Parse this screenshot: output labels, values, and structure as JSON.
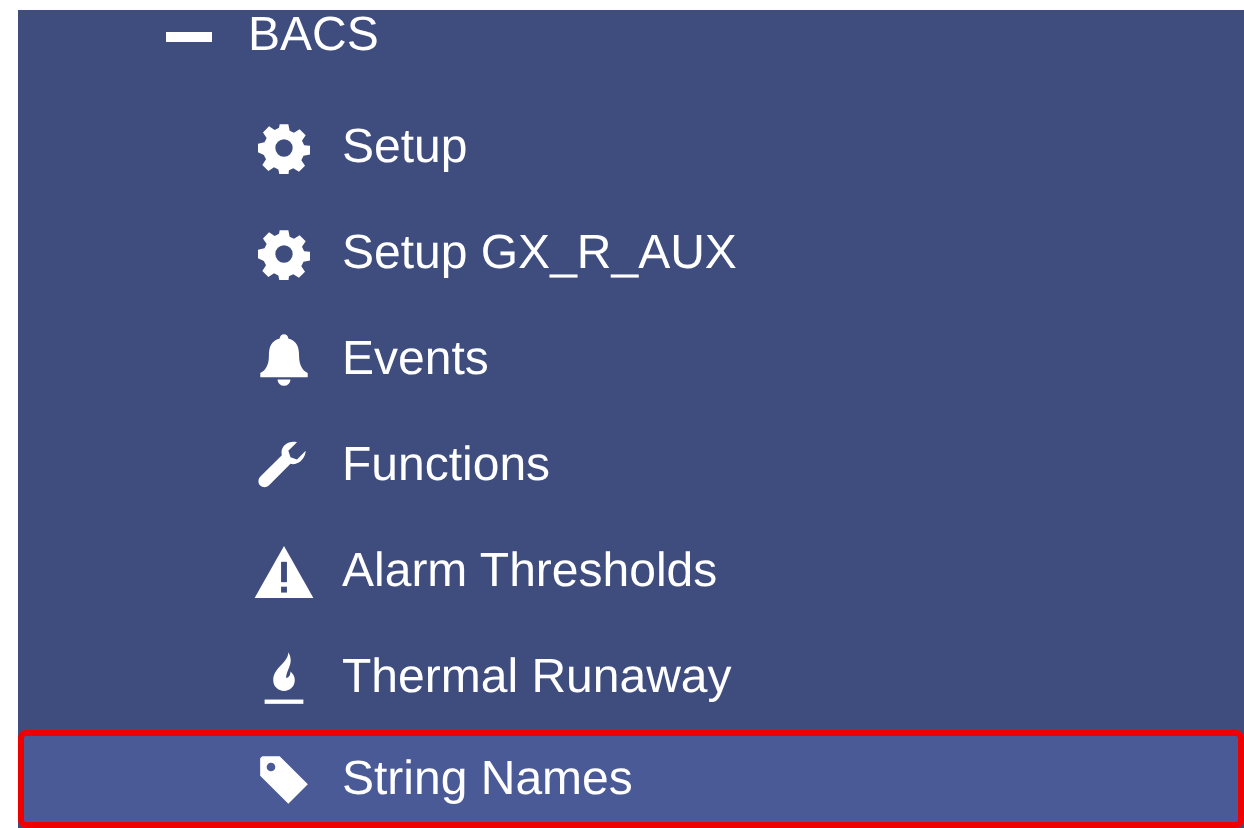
{
  "sidebar": {
    "items": [
      {
        "label": "BACS",
        "expanded": true,
        "children": [
          {
            "label": "Setup",
            "kind": "gear",
            "selected": false,
            "highlighted": false
          },
          {
            "label": "Setup GX_R_AUX",
            "kind": "gear",
            "selected": false,
            "highlighted": false
          },
          {
            "label": "Events",
            "kind": "bell",
            "selected": false,
            "highlighted": false
          },
          {
            "label": "Functions",
            "kind": "wrench",
            "selected": false,
            "highlighted": false
          },
          {
            "label": "Alarm Thresholds",
            "kind": "warning",
            "selected": false,
            "highlighted": false
          },
          {
            "label": "Thermal Runaway",
            "kind": "flame",
            "selected": false,
            "highlighted": false
          },
          {
            "label": "String Names",
            "kind": "tag",
            "selected": true,
            "highlighted": true
          }
        ]
      }
    ]
  }
}
